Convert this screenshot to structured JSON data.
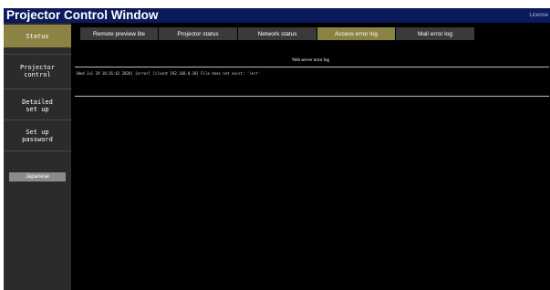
{
  "window": {
    "title": "Projector Control Window",
    "license_link": "License"
  },
  "sidebar": {
    "items": [
      {
        "label": "Status",
        "active": true
      },
      {
        "label": "Projector\ncontrol",
        "active": false
      },
      {
        "label": "Detailed\nset up",
        "active": false
      },
      {
        "label": "Set up\npassword",
        "active": false
      }
    ],
    "language_button": "Japanese"
  },
  "tabs": [
    {
      "label": "Remote preview lite",
      "active": false
    },
    {
      "label": "Projector status",
      "active": false
    },
    {
      "label": "Network status",
      "active": false
    },
    {
      "label": "Access error log",
      "active": true
    },
    {
      "label": "Mail error log",
      "active": false
    }
  ],
  "content": {
    "heading": "Web server error log",
    "log_lines": [
      "[Wed Jul 29 10:26:42 2020] [error] [client 192.168.0.10] File does not exist: '/err'"
    ]
  },
  "colors": {
    "titlebar_bg": "#0a1a5c",
    "sidebar_bg": "#2b2b2b",
    "active_gold": "#8a8344",
    "tab_bg": "#3a3a3a",
    "content_bg": "#000000",
    "language_button_bg": "#8a8a8a"
  }
}
